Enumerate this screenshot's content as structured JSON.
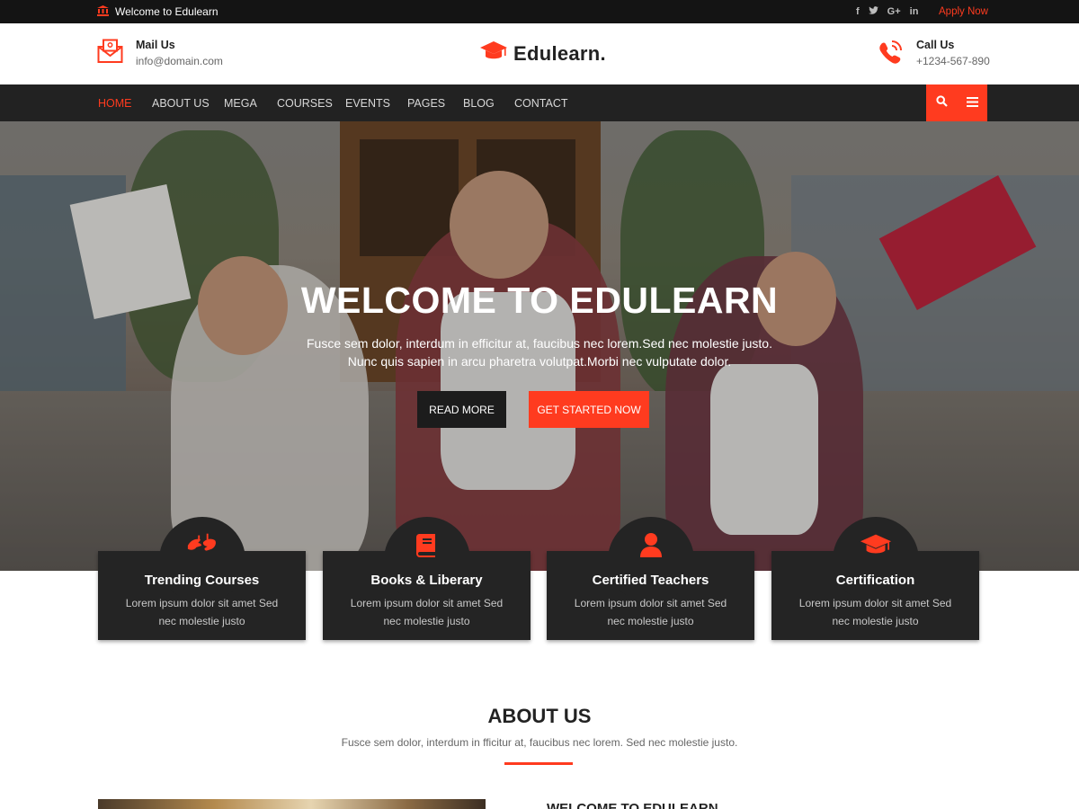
{
  "topbar": {
    "welcome": "Welcome to Edulearn",
    "social_icons": [
      "facebook-icon",
      "twitter-icon",
      "google-plus-icon",
      "linkedin-icon"
    ],
    "social_glyphs": [
      "f",
      "t",
      "G+",
      "in"
    ],
    "apply_label": "Apply Now"
  },
  "header": {
    "mail": {
      "title": "Mail Us",
      "value": "info@domain.com"
    },
    "logo": "Edulearn.",
    "call": {
      "title": "Call Us",
      "value": "+1234-567-890"
    }
  },
  "nav": {
    "items": [
      {
        "label": "HOME",
        "active": true
      },
      {
        "label": "ABOUT US"
      },
      {
        "label": "MEGA"
      },
      {
        "label": "COURSES"
      },
      {
        "label": "EVENTS"
      },
      {
        "label": "PAGES"
      },
      {
        "label": "BLOG"
      },
      {
        "label": "CONTACT"
      }
    ]
  },
  "hero": {
    "title": "WELCOME TO EDULEARN",
    "subtitle_line1": "Fusce sem dolor, interdum in efficitur at, faucibus nec lorem.Sed nec molestie justo.",
    "subtitle_line2": "Nunc quis sapien in arcu pharetra volutpat.Morbi nec vulputate dolor.",
    "read_more": "READ MORE",
    "get_started": "GET STARTED NOW"
  },
  "features": [
    {
      "title": "Trending Courses",
      "desc": "Lorem ipsum dolor sit amet Sed nec molestie justo",
      "icon": "sign-language-icon"
    },
    {
      "title": "Books & Liberary",
      "desc": "Lorem ipsum dolor sit amet Sed nec molestie justo",
      "icon": "book-icon"
    },
    {
      "title": "Certified Teachers",
      "desc": "Lorem ipsum dolor sit amet Sed nec molestie justo",
      "icon": "user-icon"
    },
    {
      "title": "Certification",
      "desc": "Lorem ipsum dolor sit amet Sed nec molestie justo",
      "icon": "graduation-cap-icon"
    }
  ],
  "about": {
    "title": "ABOUT US",
    "subtitle": "Fusce sem dolor, interdum in fficitur at, faucibus nec lorem. Sed nec molestie justo.",
    "heading": "WELCOME TO EDULEARN"
  },
  "colors": {
    "accent": "#ff3b1f",
    "dark": "#222222",
    "topbar": "#141414"
  }
}
